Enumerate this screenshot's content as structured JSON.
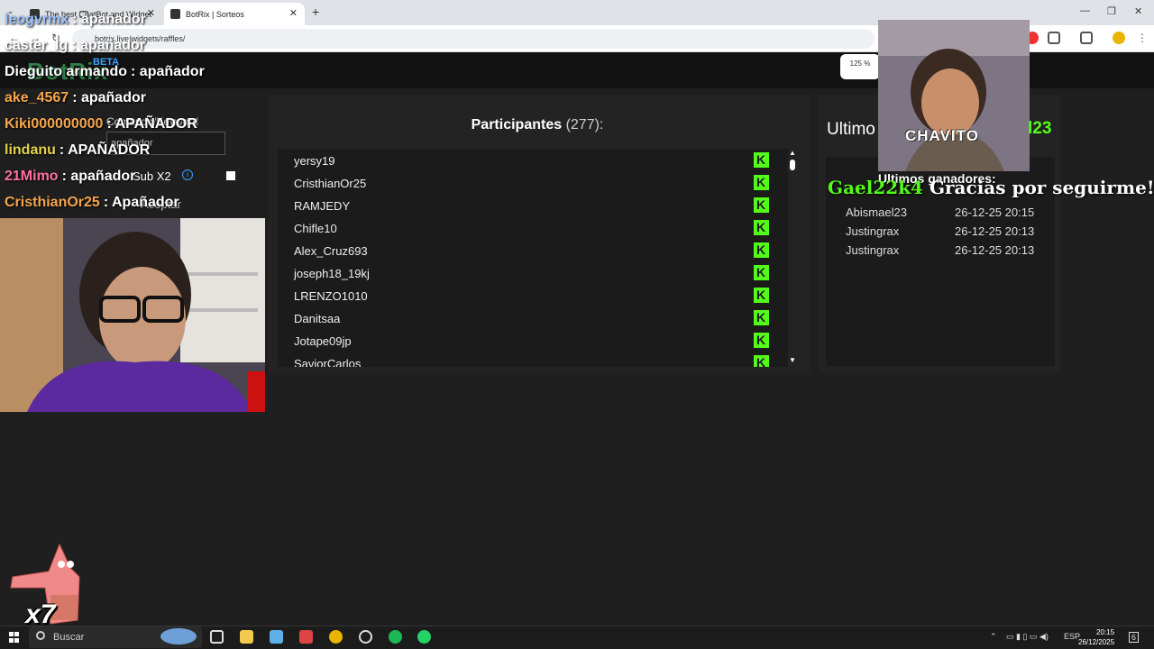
{
  "browser": {
    "tabs": [
      {
        "title": "The best ChatBot and Widget"
      },
      {
        "title": "BotRix | Sorteos"
      }
    ],
    "new_tab": "+",
    "url": "botrix.live/widgets/raffles/",
    "zoom_badge": "125 %",
    "controls": {
      "minimize": "—",
      "restore": "❐",
      "close": "✕"
    },
    "nav": {
      "back": "←",
      "forward": "→",
      "reload": "↻"
    }
  },
  "app": {
    "brand": "BotRix",
    "badge": "BETA"
  },
  "settings": {
    "keyword_label": "Comando/Keyword",
    "keyword_value": "apañador",
    "sub_label": "Sub X2",
    "accept_label": "Aceptar"
  },
  "participants": {
    "title_bold": "Participantes",
    "title_count": "(277):",
    "names": [
      "yersy19",
      "CristhianOr25",
      "RAMJEDY",
      "Chifle10",
      "Alex_Cruz693",
      "joseph18_19kj",
      "LRENZO1010",
      "Danitsaa",
      "Jotape09jp",
      "SaviorCarlos"
    ],
    "platform_icon": "kick-icon",
    "accent": "#53fc18"
  },
  "winners": {
    "title": "Ultimo",
    "title_suffix": "l23",
    "rows": [
      {
        "name": "Abismael23",
        "date": "26-12-25 20:15"
      },
      {
        "name": "Justingrax",
        "date": "26-12-25 20:13"
      },
      {
        "name": "Justingrax",
        "date": "26-12-25 20:13"
      }
    ]
  },
  "stream_overlay": {
    "chat": [
      {
        "user": "leogvrmx",
        "msg": ": apañador",
        "color": "#9ec3ff"
      },
      {
        "user": "caster_lg",
        "msg": ": apañador",
        "color": "#ffffff"
      },
      {
        "user": "Dieguito armando",
        "msg": ": apañador",
        "color": "#ffffff"
      },
      {
        "user": "ake_4567",
        "msg": ": apañador",
        "color": "#f6a54b"
      },
      {
        "user": "Kiki000000000",
        "msg": ": APAÑADOR",
        "color": "#f6a54b"
      },
      {
        "user": "lindanu",
        "msg": ": APAÑADOR",
        "color": "#e3d34b"
      },
      {
        "user": "21Mimo",
        "msg": ": apañador",
        "color": "#ff6fa0"
      },
      {
        "user": "CristhianOr25",
        "msg": ": Apañador",
        "color": "#f6a54b"
      }
    ],
    "gif_caption": "CHAVITO",
    "alert_user": "Gael22k4",
    "alert_msg": "Gracias por seguirme!!",
    "last_winners_label": "Ultimos ganadores:",
    "combo": "x7"
  },
  "taskbar": {
    "search_placeholder": "Buscar",
    "lang": "ESP",
    "time": "20:15",
    "date": "26/12/2025",
    "notif_count": "6"
  }
}
